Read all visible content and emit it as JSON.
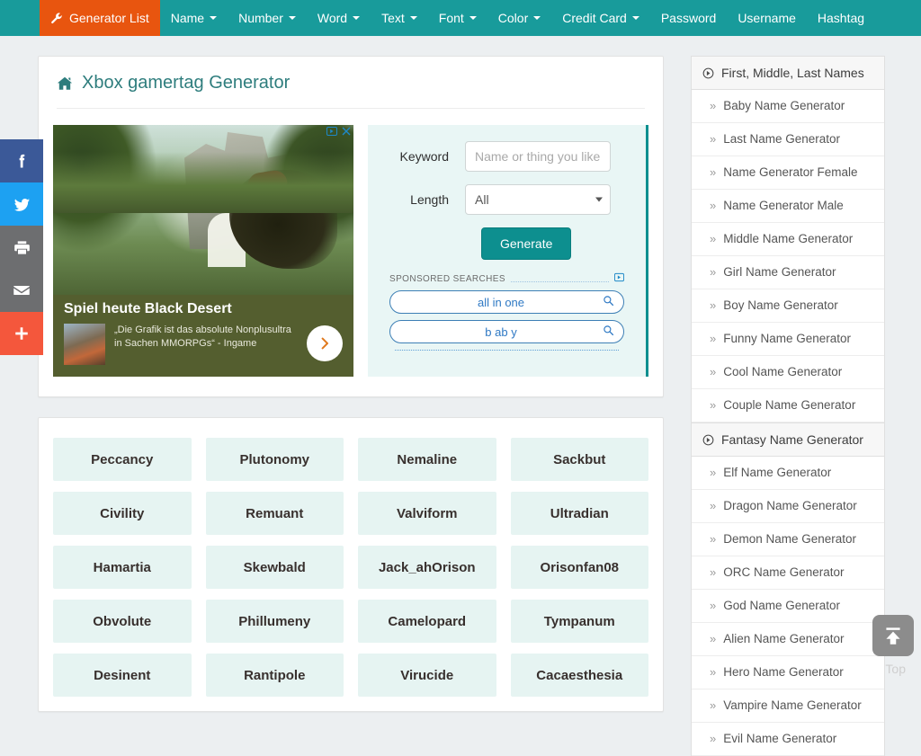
{
  "navbar": {
    "brand": {
      "label": "Generator List",
      "icon": "wrench-icon"
    },
    "items": [
      {
        "label": "Name",
        "caret": true
      },
      {
        "label": "Number",
        "caret": true
      },
      {
        "label": "Word",
        "caret": true
      },
      {
        "label": "Text",
        "caret": true
      },
      {
        "label": "Font",
        "caret": true
      },
      {
        "label": "Color",
        "caret": true
      },
      {
        "label": "Credit Card",
        "caret": true
      },
      {
        "label": "Password",
        "caret": false
      },
      {
        "label": "Username",
        "caret": false
      },
      {
        "label": "Hashtag",
        "caret": false
      }
    ]
  },
  "social": [
    {
      "name": "facebook-share-button",
      "icon": "facebook-icon",
      "color": "#3b5998"
    },
    {
      "name": "twitter-share-button",
      "icon": "twitter-icon",
      "color": "#1da1f2"
    },
    {
      "name": "print-button",
      "icon": "printer-icon",
      "color": "#6d6e70"
    },
    {
      "name": "email-share-button",
      "icon": "envelope-icon",
      "color": "#6d6e70"
    },
    {
      "name": "more-share-button",
      "icon": "plus-icon",
      "color": "#f4573c"
    }
  ],
  "page": {
    "title": "Xbox gamertag Generator",
    "home_icon": "home-icon"
  },
  "ad": {
    "headline": "Spiel heute Black Desert",
    "copy": "„Die Grafik ist das absolute Nonplusultra in Sachen MMORPGs“ - Ingame",
    "cta_icon": "chevron-right-icon",
    "info_icon": "adchoices-icon",
    "close_icon": "close-icon"
  },
  "form": {
    "keyword_label": "Keyword",
    "keyword_placeholder": "Name or thing you like",
    "keyword_value": "",
    "length_label": "Length",
    "length_value": "All",
    "length_options": [
      "All"
    ],
    "generate_label": "Generate"
  },
  "sponsored": {
    "title": "SPONSORED SEARCHES",
    "adchoices_icon": "adchoices-icon",
    "items": [
      {
        "text": "all in one",
        "icon": "search-icon"
      },
      {
        "text": "b ab y",
        "icon": "search-icon"
      }
    ]
  },
  "results": [
    "Peccancy",
    "Plutonomy",
    "Nemaline",
    "Sackbut",
    "Civility",
    "Remuant",
    "Valviform",
    "Ultradian",
    "Hamartia",
    "Skewbald",
    "Jack_ahOrison",
    "Orisonfan08",
    "Obvolute",
    "Phillumeny",
    "Camelopard",
    "Tympanum",
    "Desinent",
    "Rantipole",
    "Virucide",
    "Cacaesthesia"
  ],
  "sidebar": {
    "groups": [
      {
        "heading": "First, Middle, Last Names",
        "icon": "target-circle-icon",
        "items": [
          "Baby Name Generator",
          "Last Name Generator",
          "Name Generator Female",
          "Name Generator Male",
          "Middle Name Generator",
          "Girl Name Generator",
          "Boy Name Generator",
          "Funny Name Generator",
          "Cool Name Generator",
          "Couple Name Generator"
        ]
      },
      {
        "heading": "Fantasy Name Generator",
        "icon": "target-circle-icon",
        "items": [
          "Elf Name Generator",
          "Dragon Name Generator",
          "Demon Name Generator",
          "ORC Name Generator",
          "God Name Generator",
          "Alien Name Generator",
          "Hero Name Generator",
          "Vampire Name Generator",
          "Evil Name Generator"
        ]
      }
    ]
  },
  "back_to_top": {
    "label": "Top",
    "icon": "arrow-up-to-line-icon"
  },
  "colors": {
    "nav_bg": "#189b9b",
    "nav_active": "#e8550f",
    "accent_teal": "#0d8f8f",
    "title_teal": "#2e7d7d",
    "result_bg": "#e6f4f2",
    "form_bg": "#e9f6f5",
    "sponsored_blue": "#2f79c4"
  }
}
